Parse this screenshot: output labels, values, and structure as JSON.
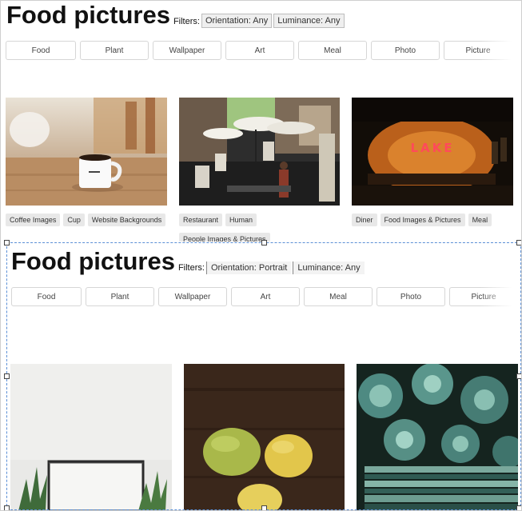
{
  "top_view": {
    "title": "Food pictures",
    "filters_label": "Filters:",
    "orientation_filter": "Orientation: Any",
    "luminance_filter": "Luminance: Any",
    "tags": [
      "Food",
      "Plant",
      "Wallpaper",
      "Art",
      "Meal",
      "Photo",
      "Picture"
    ],
    "photos": [
      {
        "alt": "coffee mug on wooden table",
        "chips": [
          "Coffee Images",
          "Cup",
          "Website Backgrounds"
        ]
      },
      {
        "alt": "street market with umbrellas",
        "chips": [
          "Restaurant",
          "Human",
          "People Images & Pictures"
        ]
      },
      {
        "alt": "neon LAKE sign in dark diner",
        "neon_text": "LAKE",
        "chips": [
          "Diner",
          "Food Images & Pictures",
          "Meal"
        ]
      }
    ]
  },
  "bottom_view": {
    "title": "Food pictures",
    "filters_label": "Filters:",
    "orientation_filter": "Orientation: Portrait",
    "luminance_filter": "Luminance: Any",
    "tags": [
      "Food",
      "Plant",
      "Wallpaper",
      "Art",
      "Meal",
      "Photo",
      "Picture"
    ],
    "photos": [
      {
        "alt": "empty frame with pineapples"
      },
      {
        "alt": "limes and lemons on wood"
      },
      {
        "alt": "succulent plants"
      }
    ]
  }
}
